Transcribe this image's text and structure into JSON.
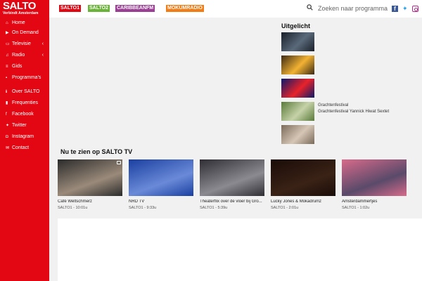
{
  "brand": {
    "name": "SALTO",
    "tagline": "Verbindt Amsterdam"
  },
  "sidebar": {
    "items": [
      {
        "label": "Home",
        "icon": "home-icon",
        "glyph": "⌂",
        "chev": ""
      },
      {
        "label": "On Demand",
        "icon": "play-icon",
        "glyph": "▶",
        "chev": ""
      },
      {
        "label": "Televisie",
        "icon": "tv-icon",
        "glyph": "▭",
        "chev": "‹"
      },
      {
        "label": "Radio",
        "icon": "music-icon",
        "glyph": "♫",
        "chev": "‹"
      },
      {
        "label": "Gids",
        "icon": "list-icon",
        "glyph": "≡",
        "chev": ""
      },
      {
        "label": "Programma's",
        "icon": "grid-icon",
        "glyph": "▪",
        "chev": ""
      },
      {
        "label": "Over SALTO",
        "icon": "info-icon",
        "glyph": "ℹ",
        "chev": ""
      },
      {
        "label": "Frequenties",
        "icon": "signal-icon",
        "glyph": "▮",
        "chev": ""
      },
      {
        "label": "Facebook",
        "icon": "facebook-icon",
        "glyph": "f",
        "chev": ""
      },
      {
        "label": "Twitter",
        "icon": "twitter-icon",
        "glyph": "✦",
        "chev": ""
      },
      {
        "label": "Instagram",
        "icon": "instagram-icon",
        "glyph": "◘",
        "chev": ""
      },
      {
        "label": "Contact",
        "icon": "contact-icon",
        "glyph": "✉",
        "chev": ""
      }
    ]
  },
  "channels": [
    "SALTO1",
    "SALTO2",
    "CARIBBEANFM",
    "MOKUMRADIO"
  ],
  "search": {
    "placeholder": "Zoeken naar programma"
  },
  "uitgelicht": {
    "title": "Uitgelicht",
    "items": [
      {
        "caption_title": "",
        "caption_sub": "",
        "colors": [
          "#1a1f2a",
          "#5a6a7a"
        ]
      },
      {
        "caption_title": "",
        "caption_sub": "",
        "colors": [
          "#3b2a14",
          "#f2b233"
        ]
      },
      {
        "caption_title": "",
        "caption_sub": "",
        "colors": [
          "#0a1a6a",
          "#e8222a"
        ]
      },
      {
        "caption_title": "Grachtenfestival",
        "caption_sub": "Grachtenfestival Yannick Hiwat Sextet",
        "colors": [
          "#5a7a3a",
          "#c6d2a8"
        ]
      },
      {
        "caption_title": "",
        "caption_sub": "",
        "colors": [
          "#7a6a5a",
          "#d6c6b6"
        ]
      }
    ]
  },
  "now": {
    "title": "Nu te zien op SALTO TV",
    "items": [
      {
        "title": "Café Weltschmerz",
        "meta": "SALTO1 - 10:01u",
        "colors": [
          "#2b2b2b",
          "#9a8a7a"
        ]
      },
      {
        "title": "NRD TV",
        "meta": "SALTO1 - 9:33u",
        "colors": [
          "#1a3fa0",
          "#6a8ad8"
        ]
      },
      {
        "title": "Theaterflix over de vloer bij Gro...",
        "meta": "SALTO1 - 5:39u",
        "colors": [
          "#2e2e34",
          "#8a8a90"
        ]
      },
      {
        "title": "Lucky Jones & Mokadrumz",
        "meta": "SALTO1 - 2:01u",
        "colors": [
          "#1a0c08",
          "#3a2216"
        ]
      },
      {
        "title": "Amsterdammertjes",
        "meta": "SALTO1 - 1:02u",
        "colors": [
          "#d86a8a",
          "#5a4a6a"
        ]
      }
    ]
  },
  "colors": {
    "brand_red": "#e30613",
    "background": "#f1f1f1"
  }
}
